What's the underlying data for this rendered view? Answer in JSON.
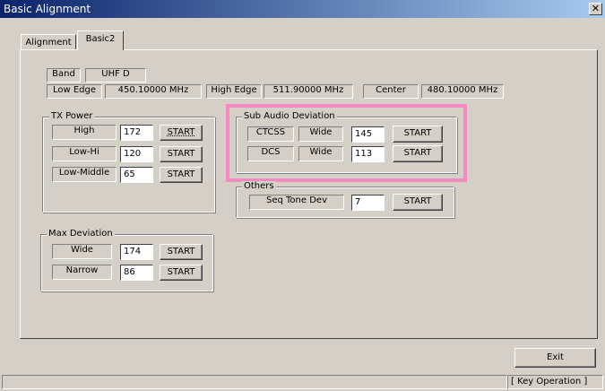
{
  "window": {
    "title": "Basic Alignment",
    "close_glyph": "✕"
  },
  "tabs": [
    {
      "label": "Alignment",
      "active": false
    },
    {
      "label": "Basic2",
      "active": true
    }
  ],
  "band": {
    "label": "Band",
    "value": "UHF D",
    "low_edge_label": "Low Edge",
    "low_edge_value": "450.10000 MHz",
    "high_edge_label": "High Edge",
    "high_edge_value": "511.90000 MHz",
    "center_label": "Center",
    "center_value": "480.10000 MHz"
  },
  "tx_power": {
    "title": "TX Power",
    "rows": [
      {
        "label": "High",
        "value": "172",
        "button": "START"
      },
      {
        "label": "Low-Hi",
        "value": "120",
        "button": "START"
      },
      {
        "label": "Low-Middle",
        "value": "65",
        "button": "START"
      }
    ]
  },
  "sub_audio": {
    "title": "Sub Audio Deviation",
    "highlight_color": "#f58ac3",
    "rows": [
      {
        "label": "CTCSS",
        "mode": "Wide",
        "value": "145",
        "button": "START"
      },
      {
        "label": "DCS",
        "mode": "Wide",
        "value": "113",
        "button": "START"
      }
    ]
  },
  "others": {
    "title": "Others",
    "label": "Seq Tone Dev",
    "value": "7",
    "button": "START"
  },
  "max_deviation": {
    "title": "Max Deviation",
    "rows": [
      {
        "label": "Wide",
        "value": "174",
        "button": "START"
      },
      {
        "label": "Narrow",
        "value": "86",
        "button": "START"
      }
    ]
  },
  "footer": {
    "exit_label": "Exit",
    "status_mode": "[ Key Operation ]"
  }
}
